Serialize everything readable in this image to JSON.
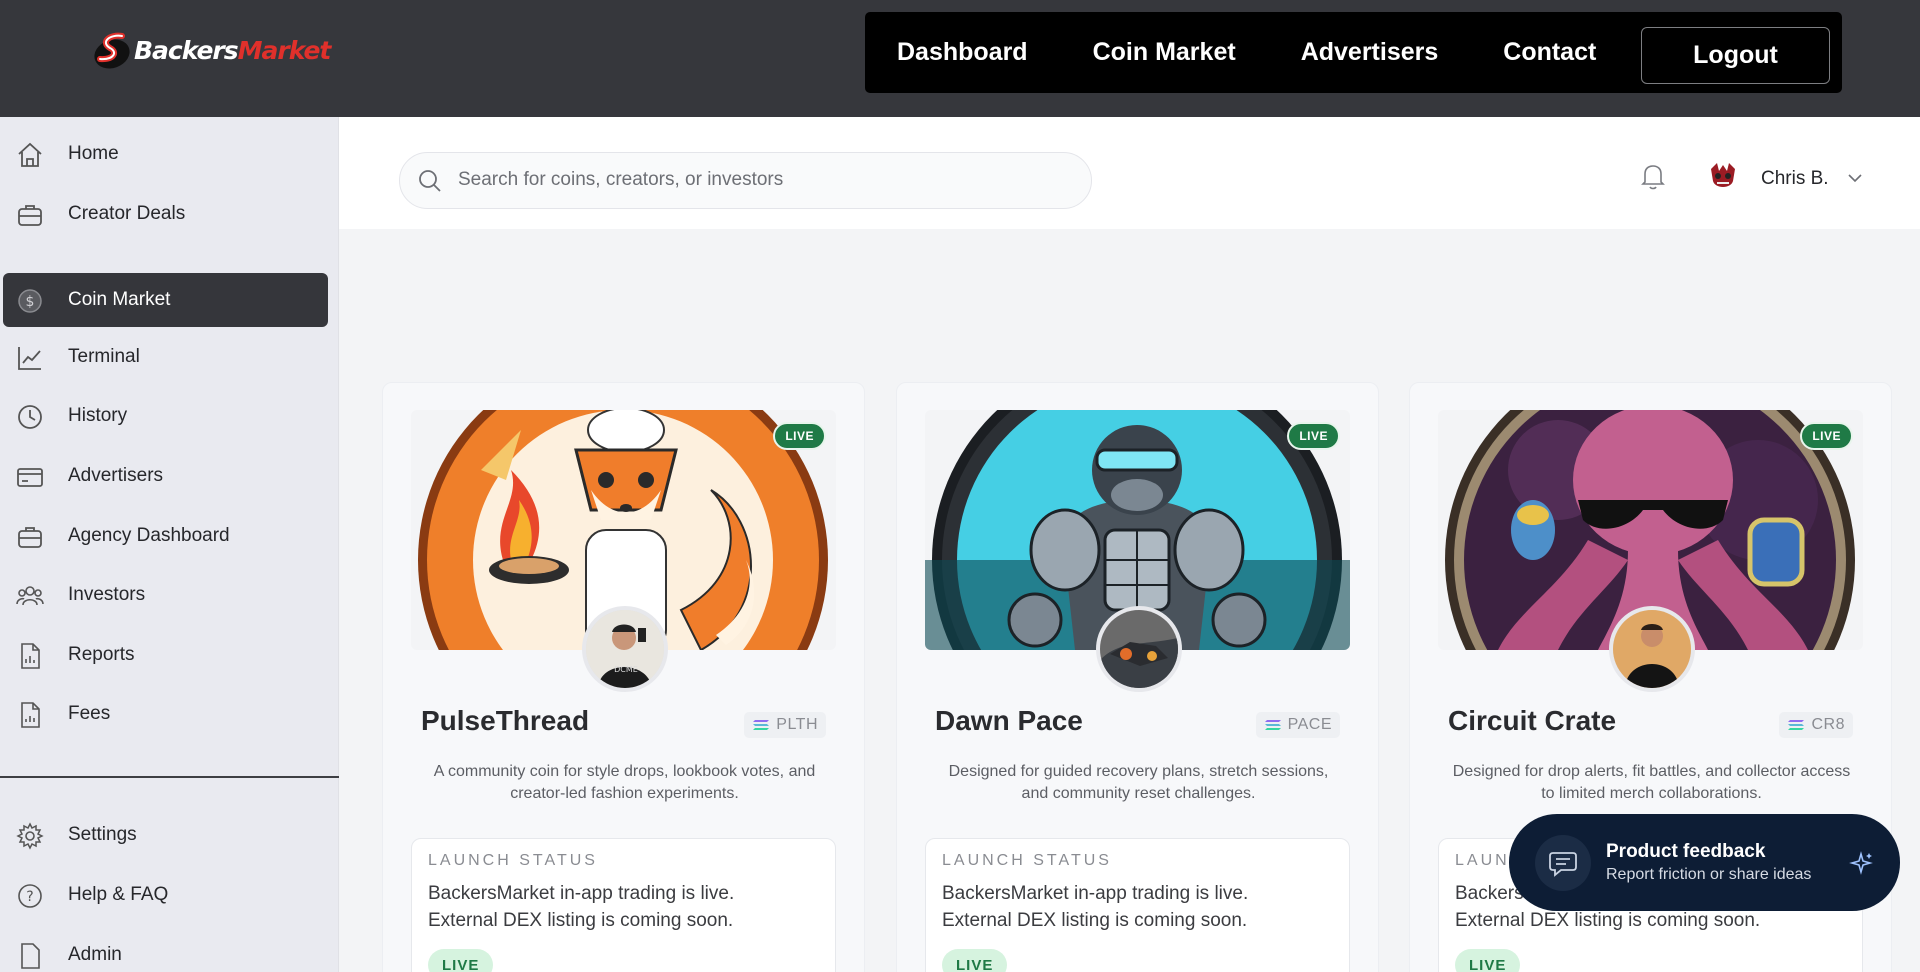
{
  "brand": {
    "part1": "Backers",
    "part2": "Market"
  },
  "topnav": {
    "links": [
      "Dashboard",
      "Coin Market",
      "Advertisers",
      "Contact"
    ],
    "logout": "Logout"
  },
  "sidebar": {
    "items": [
      {
        "label": "Home",
        "icon": "home-icon"
      },
      {
        "label": "Creator Deals",
        "icon": "briefcase-icon"
      },
      {
        "label": "Coin Market",
        "icon": "dollar-coin-icon"
      },
      {
        "label": "Terminal",
        "icon": "chart-icon"
      },
      {
        "label": "History",
        "icon": "clock-icon"
      },
      {
        "label": "Advertisers",
        "icon": "card-icon"
      },
      {
        "label": "Agency Dashboard",
        "icon": "briefcase-icon"
      },
      {
        "label": "Investors",
        "icon": "users-icon"
      },
      {
        "label": "Reports",
        "icon": "report-icon"
      },
      {
        "label": "Fees",
        "icon": "receipt-icon"
      }
    ],
    "bottom_items": [
      {
        "label": "Settings",
        "icon": "gear-icon"
      },
      {
        "label": "Help & FAQ",
        "icon": "help-icon"
      },
      {
        "label": "Admin",
        "icon": "admin-icon"
      }
    ],
    "active": "Coin Market"
  },
  "search": {
    "placeholder": "Search for coins, creators, or investors"
  },
  "user": {
    "name": "Chris B."
  },
  "cards": [
    {
      "name": "PulseThread",
      "ticker": "PLTH",
      "badge": "LIVE",
      "description": "A community coin for style drops, lookbook votes, and creator-led fashion experiments.",
      "status_label": "LAUNCH STATUS",
      "status_line1": "BackersMarket in-app trading is live.",
      "status_line2": "External DEX listing is coming soon.",
      "status_pill": "LIVE"
    },
    {
      "name": "Dawn Pace",
      "ticker": "PACE",
      "badge": "LIVE",
      "description": "Designed for guided recovery plans, stretch sessions, and community reset challenges.",
      "status_label": "LAUNCH STATUS",
      "status_line1": "BackersMarket in-app trading is live.",
      "status_line2": "External DEX listing is coming soon.",
      "status_pill": "LIVE"
    },
    {
      "name": "Circuit Crate",
      "ticker": "CR8",
      "badge": "LIVE",
      "description": "Designed for drop alerts, fit battles, and collector access to limited merch collaborations.",
      "status_label": "LAUNCH STATUS",
      "status_line1": "BackersMarket in-app trading is live.",
      "status_line2": "External DEX listing is coming soon.",
      "status_pill": "LIVE"
    }
  ],
  "feedback": {
    "title": "Product feedback",
    "subtitle": "Report friction or share ideas"
  },
  "colors": {
    "header": "#36373c",
    "nav": "#000000",
    "active": "#35363b",
    "live": "#1f7a46",
    "feedback": "#0d1d35",
    "brand_red": "#e0302b"
  }
}
